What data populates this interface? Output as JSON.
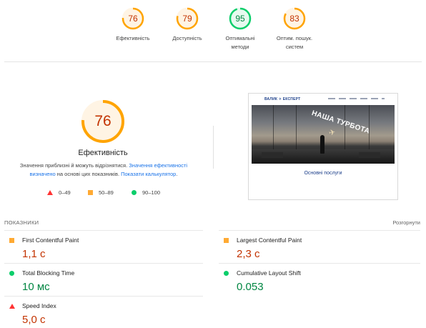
{
  "top_scores": [
    {
      "score": "76",
      "label_lines": [
        "Ефективність"
      ],
      "status": "average",
      "color": "#ffa400",
      "fraction": 0.76
    },
    {
      "score": "79",
      "label_lines": [
        "Доступність"
      ],
      "status": "average",
      "color": "#ffa400",
      "fraction": 0.79
    },
    {
      "score": "95",
      "label_lines": [
        "Оптимальні",
        "методи"
      ],
      "status": "pass",
      "color": "#0cce6b",
      "fraction": 0.95
    },
    {
      "score": "83",
      "label_lines": [
        "Оптим. пошук.",
        "систем"
      ],
      "status": "average",
      "color": "#ffa400",
      "fraction": 0.83
    }
  ],
  "main": {
    "score": "76",
    "fraction": 0.76,
    "color": "#ffa400",
    "title": "Ефективність",
    "desc_part1": "Значення приблизні й можуть відрізнятися. ",
    "desc_link1": "Значення ефективності визначено",
    "desc_part2": " на основі цих показників. ",
    "desc_link2": "Показати калькулятор",
    "desc_part3": "."
  },
  "legend": [
    {
      "range": "0–49",
      "shape": "triangle",
      "color": "#ff3333"
    },
    {
      "range": "50–89",
      "shape": "square",
      "color": "#ffaa33"
    },
    {
      "range": "90–100",
      "shape": "circle",
      "color": "#0cce6b"
    }
  ],
  "thumbnail": {
    "logo": "ВАЛИК ✈ ЕКСПЕРТ",
    "hero_text": "НАША ТУРБОТА",
    "caption": "Основні послуги"
  },
  "metrics_header": {
    "label": "ПОКАЗНИКИ",
    "expand": "Розгорнути"
  },
  "metrics": [
    {
      "name": "First Contentful Paint",
      "value": "1,1 с",
      "status": "average"
    },
    {
      "name": "Largest Contentful Paint",
      "value": "2,3 с",
      "status": "average"
    },
    {
      "name": "Total Blocking Time",
      "value": "10 мс",
      "status": "pass"
    },
    {
      "name": "Cumulative Layout Shift",
      "value": "0.053",
      "status": "pass"
    },
    {
      "name": "Speed Index",
      "value": "5,0 с",
      "status": "fail"
    }
  ],
  "colors": {
    "pass": "#0cce6b",
    "average": "#ffa400",
    "fail": "#ff3333",
    "link": "#1a73e8"
  }
}
